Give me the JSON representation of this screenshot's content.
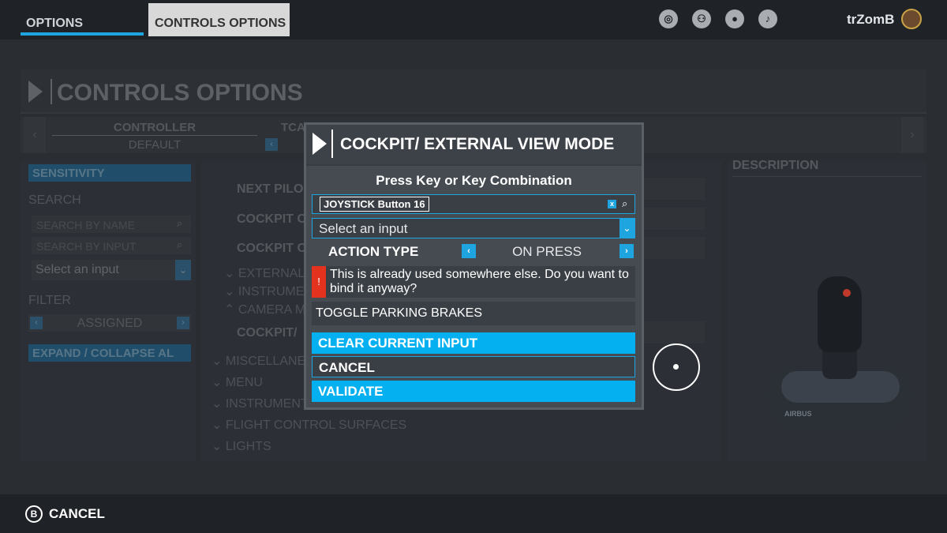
{
  "topbar": {
    "tab_options": "OPTIONS",
    "tab_controls": "CONTROLS OPTIONS",
    "username": "trZomB",
    "icons": [
      "broadcast-icon",
      "friends-icon",
      "profile-icon",
      "notifications-icon"
    ]
  },
  "page": {
    "title": "CONTROLS OPTIONS",
    "controller_label": "CONTROLLER",
    "controller_value": "DEFAULT",
    "device_label": "TCA"
  },
  "left": {
    "sensitivity": "SENSITIVITY",
    "search_label": "SEARCH",
    "search_name_placeholder": "SEARCH BY NAME",
    "search_input_placeholder": "SEARCH BY INPUT",
    "select_input": "Select an input",
    "filter_label": "FILTER",
    "filter_value": "ASSIGNED",
    "expand_collapse": "EXPAND / COLLAPSE AL"
  },
  "middle": {
    "items": [
      "NEXT PILO",
      "COCKPIT C",
      "COCKPIT C",
      "COCKPIT/"
    ],
    "categories": [
      "EXTERNAL",
      "INSTRUME",
      "CAMERA M",
      "MISCELLANE",
      "MENU",
      "INSTRUMENT",
      "FLIGHT CONTROL SURFACES",
      "LIGHTS"
    ]
  },
  "right": {
    "description_label": "DESCRIPTION",
    "device_brand": "AIRBUS"
  },
  "modal": {
    "title": "COCKPIT/ EXTERNAL VIEW MODE",
    "prompt": "Press Key or Key Combination",
    "input_value": "JOYSTICK Button 16",
    "select_placeholder": "Select an input",
    "action_type_label": "ACTION TYPE",
    "action_type_value": "ON PRESS",
    "warning": "This is already used somewhere else. Do you want to bind it anyway?",
    "conflict_binding": "TOGGLE PARKING BRAKES",
    "clear_button": "CLEAR CURRENT INPUT",
    "cancel_button": "CANCEL",
    "validate_button": "VALIDATE"
  },
  "bottombar": {
    "cancel_key": "B",
    "cancel_label": "CANCEL"
  },
  "colors": {
    "accent": "#05b0f0",
    "warning": "#e3331f",
    "background": "#2a2d31"
  }
}
